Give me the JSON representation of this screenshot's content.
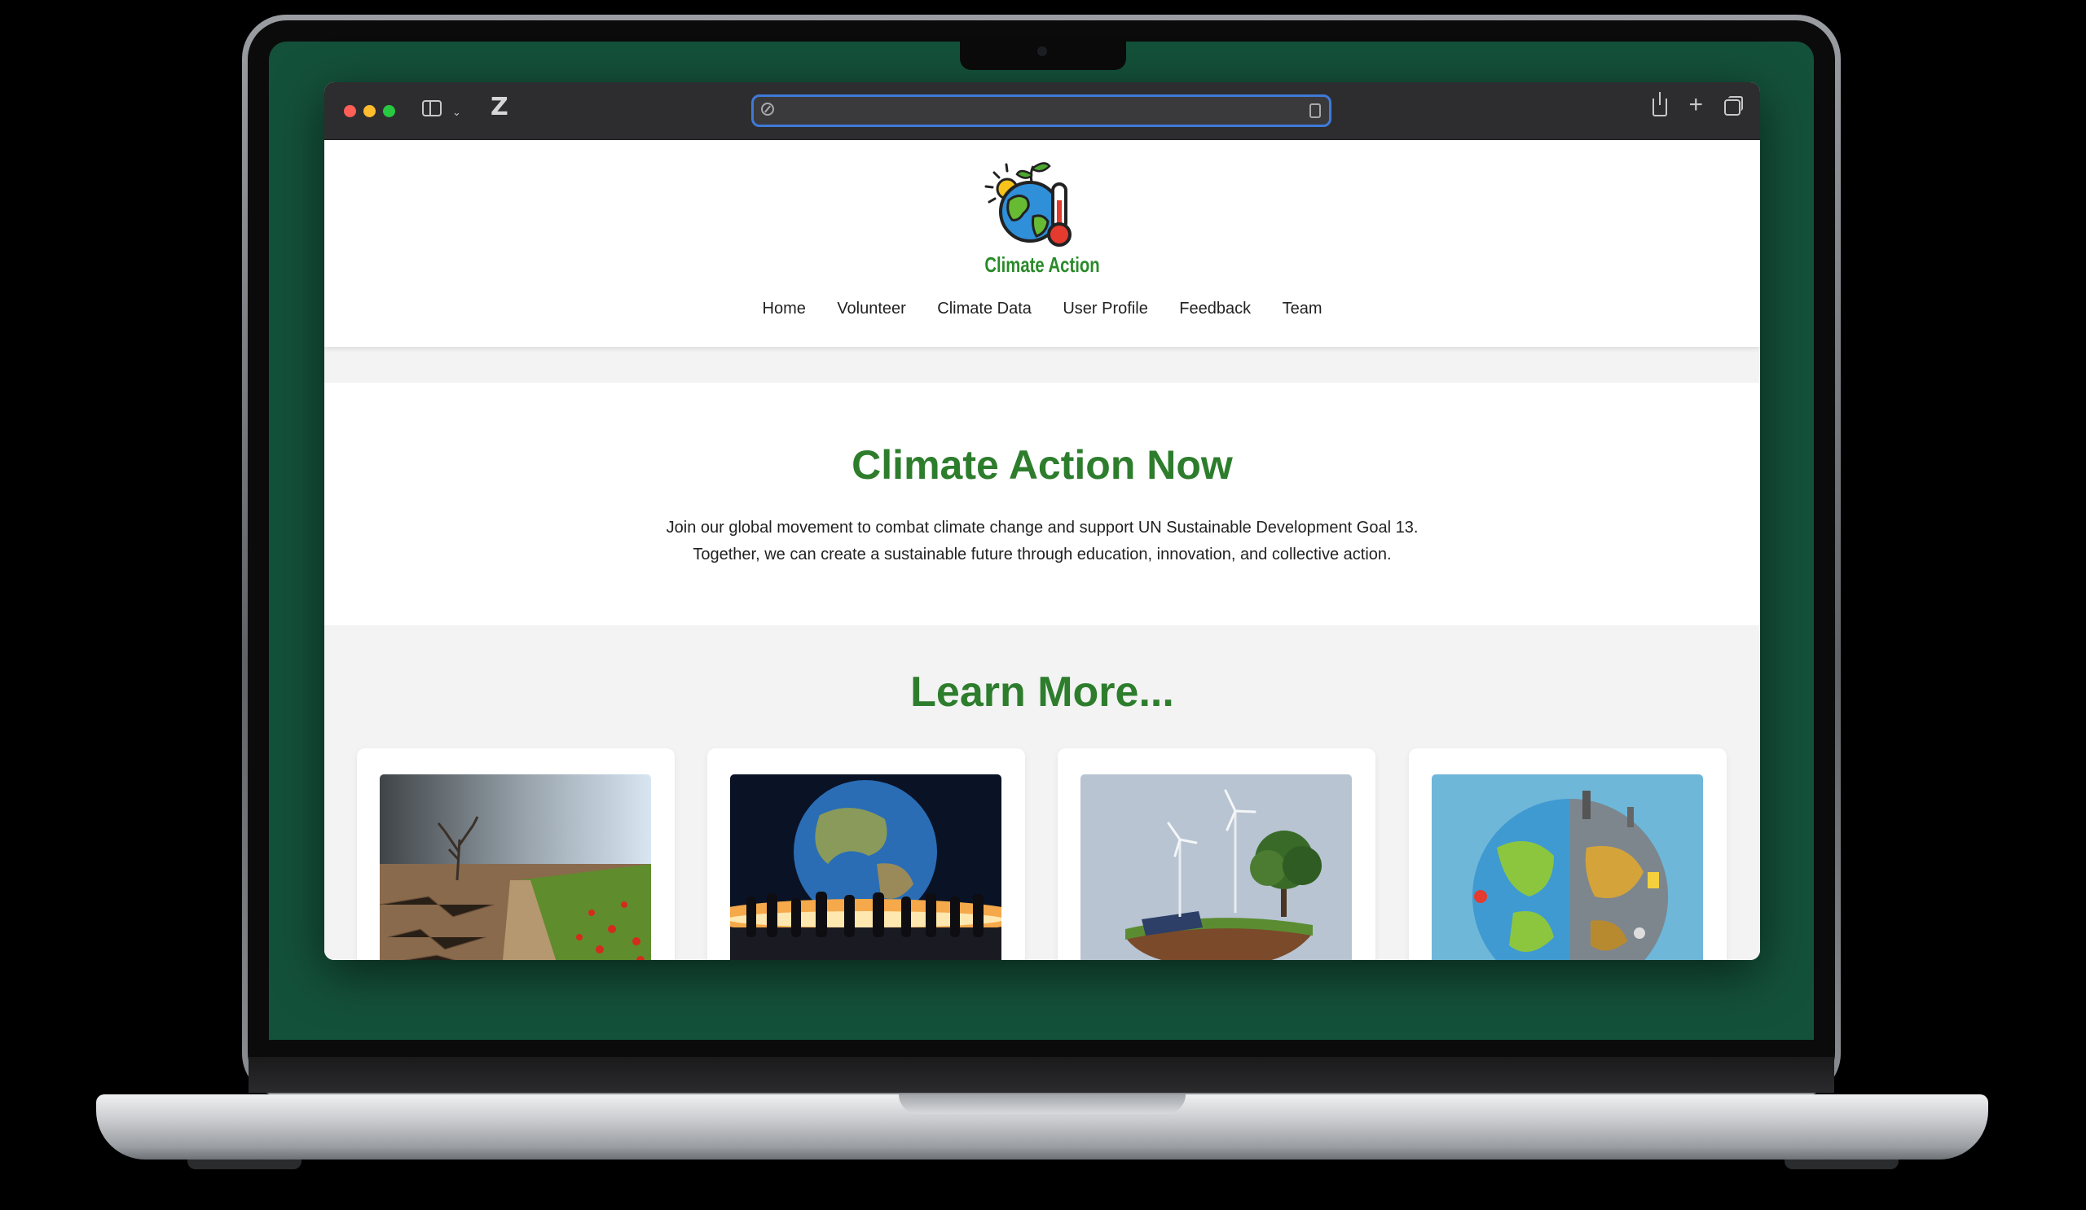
{
  "site": {
    "logo_text": "Climate Action",
    "nav": [
      "Home",
      "Volunteer",
      "Climate Data",
      "User Profile",
      "Feedback",
      "Team"
    ]
  },
  "hero": {
    "title": "Climate Action Now",
    "line1": "Join our global movement to combat climate change and support UN Sustainable Development Goal 13.",
    "line2": "Together, we can create a sustainable future through education, innovation, and collective action."
  },
  "learn_more": {
    "title": "Learn More...",
    "cards": [
      {
        "image": "drought-vs-green-field-image"
      },
      {
        "image": "people-watching-earth-image"
      },
      {
        "image": "wind-turbines-solar-island-image"
      },
      {
        "image": "half-polluted-earth-image"
      }
    ]
  },
  "colors": {
    "brand_green": "#2d7d2d",
    "laptop_screen": "#14513a",
    "url_focus": "#3f7ad9"
  },
  "icons": [
    "sidebar-icon",
    "chevron-down-icon",
    "zotero-icon",
    "compass-icon",
    "reader-icon",
    "share-icon",
    "plus-icon",
    "tabs-icon"
  ]
}
